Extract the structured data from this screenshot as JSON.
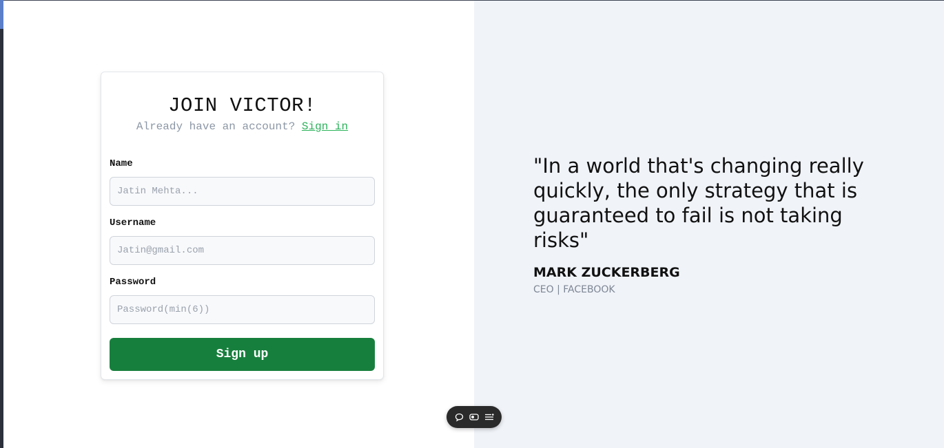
{
  "signup_card": {
    "title": "JOIN VICTOR!",
    "subtitle_prefix": "Already have an account?",
    "signin_link": "Sign in",
    "name_label": "Name",
    "name_placeholder": "Jatin Mehta...",
    "username_label": "Username",
    "username_placeholder": "Jatin@gmail.com",
    "password_label": "Password",
    "password_placeholder": "Password(min(6))",
    "submit_label": "Sign up"
  },
  "quote_panel": {
    "quote_text": "\"In a world that's changing really quickly, the only strategy that is guaranteed to fail is not taking risks\"",
    "author_name": "MARK ZUCKERBERG",
    "author_title": "CEO | FACEBOOK"
  },
  "floating_toolbar": {
    "icons": [
      "comment-icon",
      "toggle-icon",
      "menu-list-icon"
    ]
  },
  "colors": {
    "accent_green": "#177f3d",
    "link_green": "#2bb35a",
    "right_pane_bg": "#f0f3f8"
  }
}
